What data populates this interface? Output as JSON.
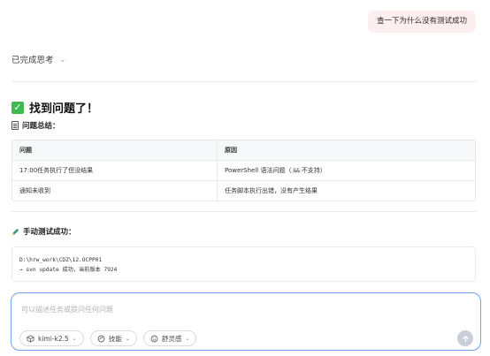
{
  "user_message": "查一下为什么没有测试成功",
  "thinking": {
    "label": "已完成思考",
    "chevron": "chevron-down-icon"
  },
  "result": {
    "title": "找到问题了！",
    "title_icon": "check-mark-icon",
    "summary_heading": "问题总结：",
    "summary_icon": "document-icon",
    "table": {
      "headers": [
        "问题",
        "原因"
      ],
      "rows": [
        [
          "17:00任务执行了但没结果",
          "PowerShell 语法问题（",
          "&&",
          " 不支持）"
        ],
        [
          "通知未收到",
          "任务脚本执行出错，没有产生结果"
        ]
      ]
    },
    "manual_heading": "手动测试成功：",
    "manual_icon": "pencil-icon",
    "code_lines": [
      "D:\\hrw_work\\CDZ\\12.OCPP01",
      "→ svn update 成功，当前版本 7924"
    ]
  },
  "composer": {
    "placeholder": "可以描述任务或提问任何问题",
    "chips": [
      {
        "label": "kimi-k2.5",
        "icon": "cube-icon"
      },
      {
        "label": "技能",
        "icon": "skill-icon"
      },
      {
        "label": "舒灵感",
        "icon": "sparkle-icon"
      }
    ],
    "send_icon": "send-arrow-up-icon",
    "accent": "#6fa3f2"
  },
  "colors": {
    "user_bubble": "#fdeef0",
    "check_green": "#3fb950"
  }
}
